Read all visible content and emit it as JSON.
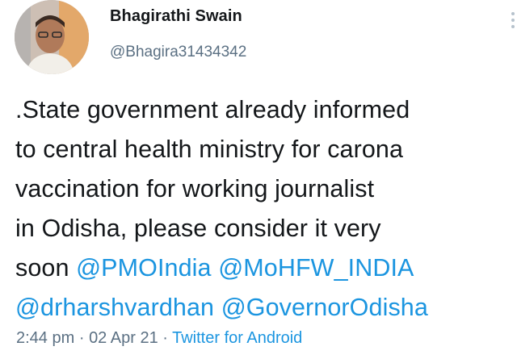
{
  "author": {
    "name": "Bhagirathi Swain",
    "handle": "@Bhagira31434342"
  },
  "tweet": {
    "lines": [
      [
        {
          "text": ".State government already informed"
        }
      ],
      [
        {
          "text": "to central health ministry for carona"
        }
      ],
      [
        {
          "text": "vaccination for working journalist"
        }
      ],
      [
        {
          "text": "in Odisha, please consider it very"
        }
      ],
      [
        {
          "text": "soon "
        },
        {
          "text": "@PMOIndia",
          "mention": true
        },
        {
          "text": " "
        },
        {
          "text": "@MoHFW_INDIA",
          "mention": true
        }
      ],
      [
        {
          "text": "@drharshvardhan",
          "mention": true
        },
        {
          "text": " "
        },
        {
          "text": "@GovernorOdisha",
          "mention": true
        }
      ]
    ]
  },
  "meta": {
    "time": "2:44 pm",
    "separator": "·",
    "date": "02 Apr 21",
    "source": "Twitter for Android"
  },
  "icons": {
    "more": "more-vertical-icon"
  },
  "colors": {
    "link": "#1b95e0",
    "secondary_text": "#5b7083",
    "primary_text": "#14171a"
  }
}
